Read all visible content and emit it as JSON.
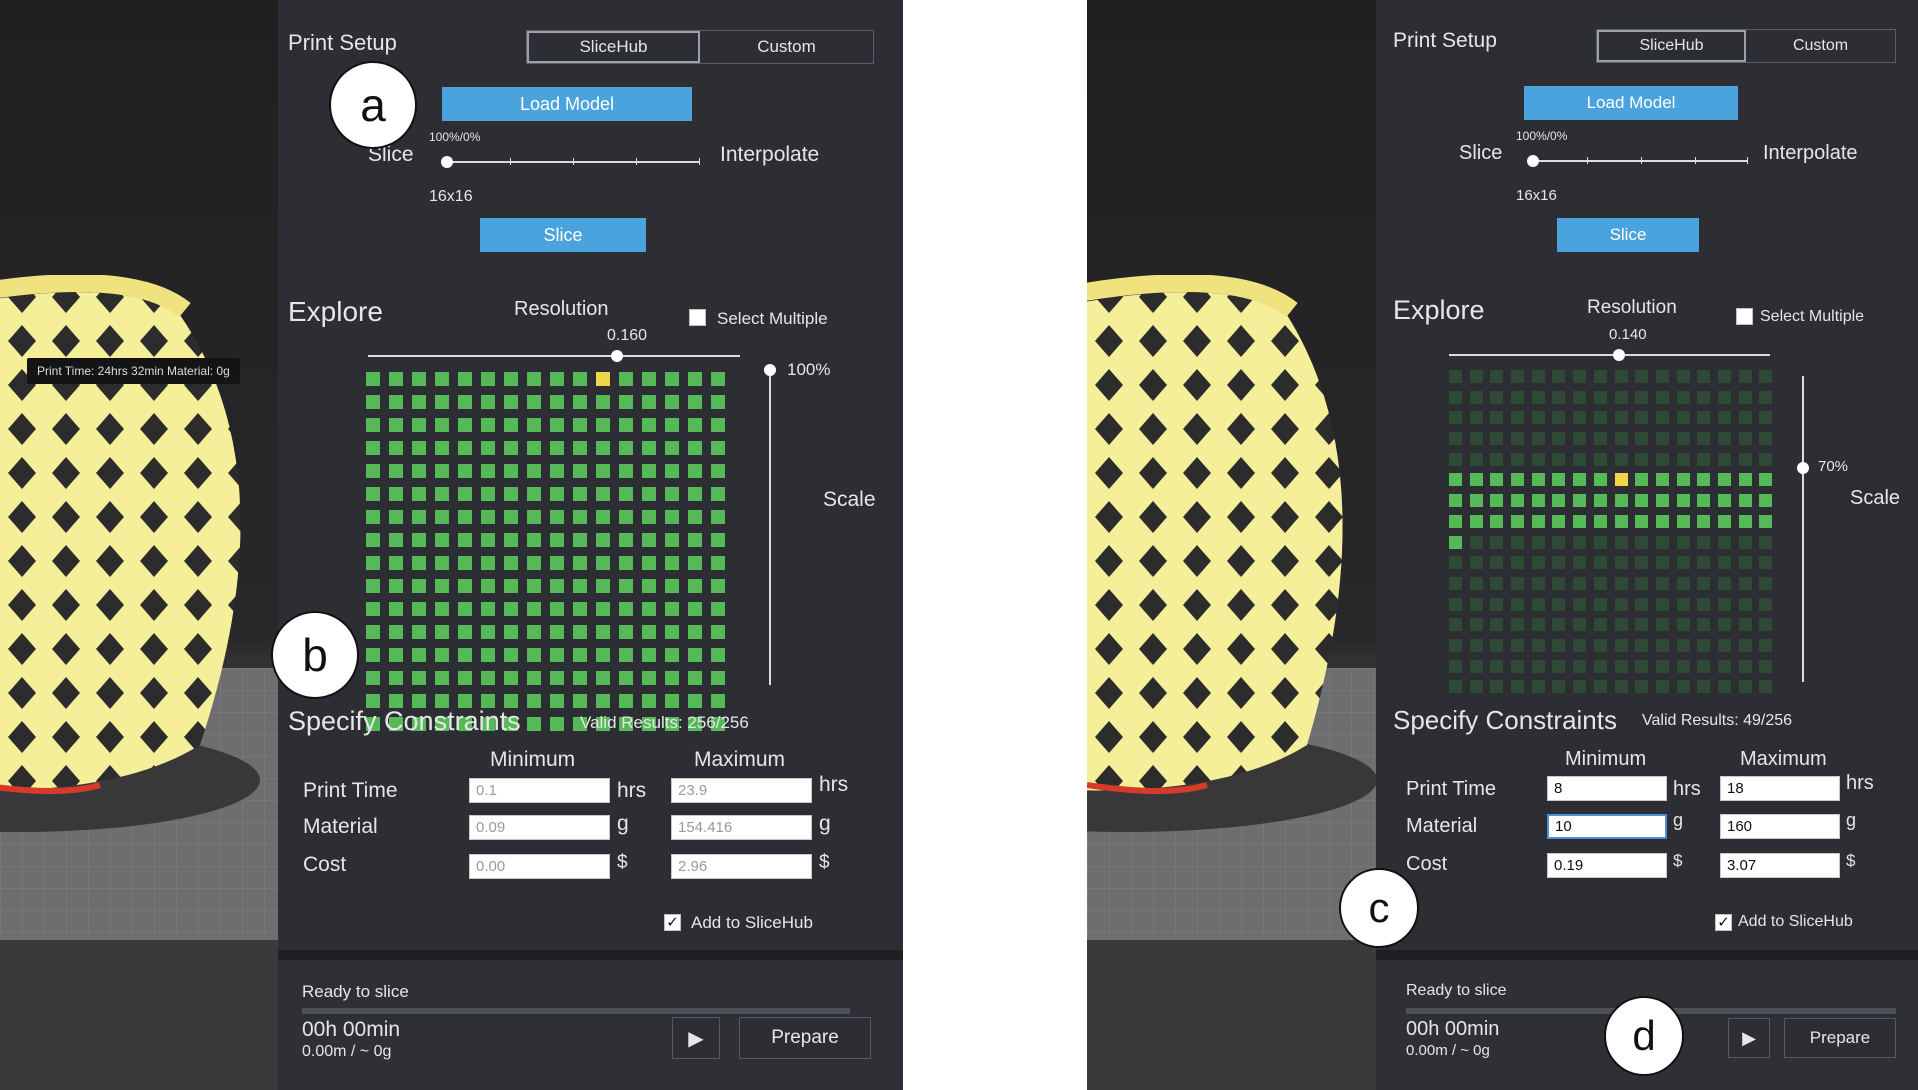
{
  "screens": {
    "left": {
      "tooltip": "Print Time: 24hrs 32min Material: 0g",
      "print_setup": {
        "title": "Print Setup",
        "tabs": [
          "SliceHub",
          "Custom"
        ],
        "load_model": "Load Model",
        "slice_label": "Slice",
        "interpolate_label": "Interpolate",
        "slider_value": "100%/0%",
        "grid_size": "16x16",
        "slice_button": "Slice"
      },
      "explore": {
        "title": "Explore",
        "resolution_label": "Resolution",
        "resolution_value": "0.160",
        "select_multiple": "Select Multiple",
        "scale_label": "Scale",
        "scale_value": "100%",
        "scale_fraction": 1.0,
        "resolution_fraction": 0.67,
        "green_rows": [
          0,
          15
        ],
        "selected_cell": [
          0,
          10
        ]
      },
      "constraints": {
        "title": "Specify Constraints",
        "valid_results": "Valid Results: 256/256",
        "col_min": "Minimum",
        "col_max": "Maximum",
        "rows": [
          {
            "label": "Print Time",
            "min": "0.1",
            "min_unit": "hrs",
            "max": "23.9",
            "max_unit": "hrs"
          },
          {
            "label": "Material",
            "min": "0.09",
            "min_unit": "g",
            "max": "154.416",
            "max_unit": "g"
          },
          {
            "label": "Cost",
            "min": "0.00",
            "min_unit": "$",
            "max": "2.96",
            "max_unit": "$"
          }
        ],
        "add_to_slicehub": "Add to SliceHub",
        "check_mark": "✓"
      },
      "status": {
        "ready": "Ready to slice",
        "time": "00h 00min",
        "material": "0.00m / ~ 0g",
        "play": "▶",
        "prepare": "Prepare"
      },
      "markers": [
        "a",
        "b"
      ]
    },
    "right": {
      "print_setup": {
        "title": "Print Setup",
        "tabs": [
          "SliceHub",
          "Custom"
        ],
        "load_model": "Load Model",
        "slice_label": "Slice",
        "interpolate_label": "Interpolate",
        "slider_value": "100%/0%",
        "grid_size": "16x16",
        "slice_button": "Slice"
      },
      "explore": {
        "title": "Explore",
        "resolution_label": "Resolution",
        "resolution_value": "0.140",
        "select_multiple": "Select Multiple",
        "scale_label": "Scale",
        "scale_value": "70%",
        "scale_fraction": 0.7,
        "resolution_fraction": 0.53,
        "green_rows": [
          5,
          7
        ],
        "extra_green": [
          [
            8,
            0
          ]
        ],
        "selected_cell": [
          5,
          8
        ]
      },
      "constraints": {
        "title": "Specify Constraints",
        "valid_results": "Valid Results: 49/256",
        "col_min": "Minimum",
        "col_max": "Maximum",
        "rows": [
          {
            "label": "Print Time",
            "min": "8",
            "min_unit": "hrs",
            "max": "18",
            "max_unit": "hrs"
          },
          {
            "label": "Material",
            "min": "10",
            "min_unit": "g",
            "max": "160",
            "max_unit": "g"
          },
          {
            "label": "Cost",
            "min": "0.19",
            "min_unit": "$",
            "max": "3.07",
            "max_unit": "$"
          }
        ],
        "add_to_slicehub": "Add to SliceHub",
        "check_mark": "✓"
      },
      "status": {
        "ready": "Ready to slice",
        "time": "00h 00min",
        "material": "0.00m / ~ 0g",
        "play": "▶",
        "prepare": "Prepare"
      },
      "markers": [
        "c",
        "d"
      ]
    }
  }
}
